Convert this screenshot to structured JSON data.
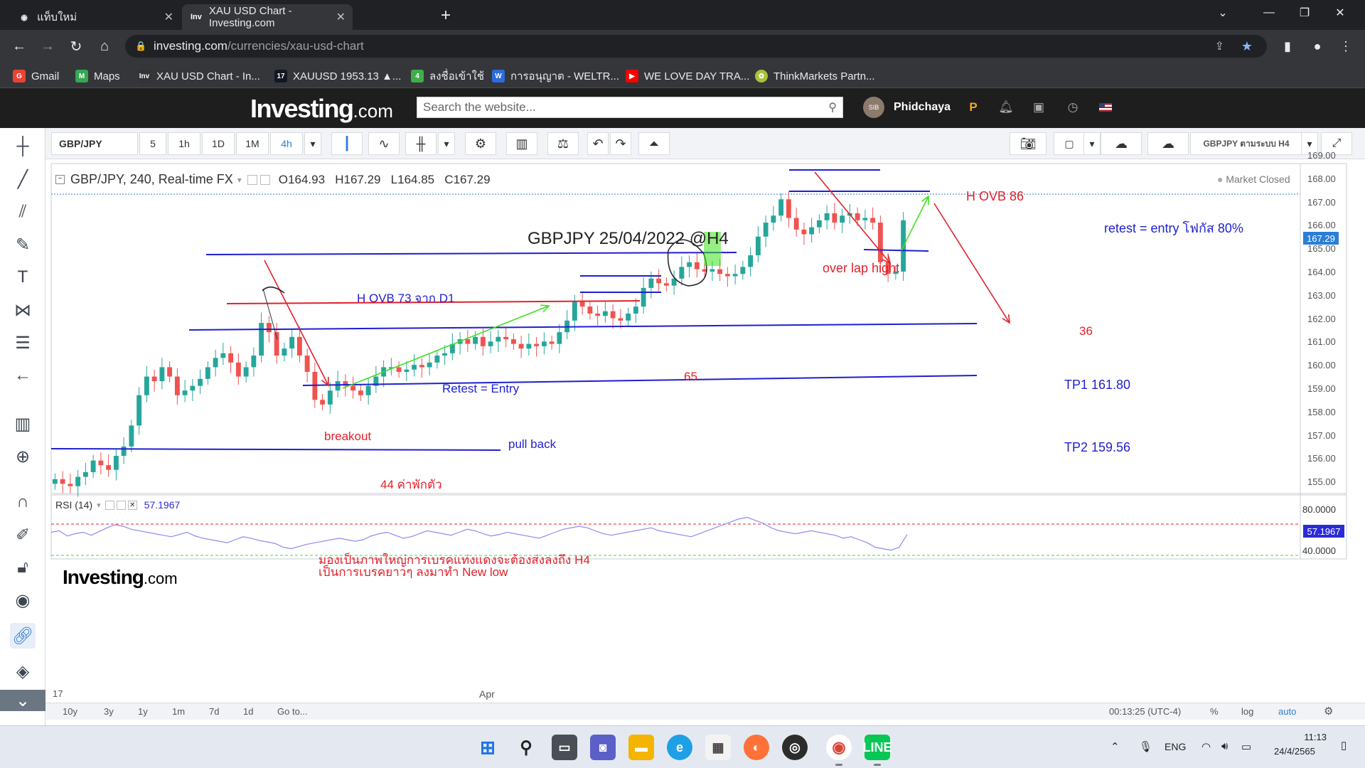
{
  "browser": {
    "tabs": [
      {
        "label": "แท็บใหม่",
        "active": false
      },
      {
        "label": "XAU USD Chart - Investing.com",
        "active": true
      }
    ],
    "url_host": "investing.com",
    "url_path": "/currencies/xau-usd-chart",
    "bookmarks": [
      {
        "label": "Gmail",
        "icon": "gmail-icon",
        "color": "#ea4335"
      },
      {
        "label": "Maps",
        "icon": "maps-icon",
        "color": "#34a853"
      },
      {
        "label": "XAU USD Chart - In...",
        "icon": "investing-icon",
        "color": "#333333"
      },
      {
        "label": "XAUUSD 1953.13 ▲...",
        "icon": "tradingview-icon",
        "color": "#131722"
      },
      {
        "label": "ลงชื่อเข้าใช้",
        "icon": "signin-icon",
        "color": "#3fae49"
      },
      {
        "label": "การอนุญาต - WELTR...",
        "icon": "weltrade-icon",
        "color": "#2d6cdf"
      },
      {
        "label": "WE LOVE DAY TRA...",
        "icon": "youtube-icon",
        "color": "#ff0000"
      },
      {
        "label": "ThinkMarkets Partn...",
        "icon": "thinkmarkets-icon",
        "color": "#a8c239"
      }
    ]
  },
  "site": {
    "logo_main": "Investing",
    "logo_suffix": ".com",
    "search_placeholder": "Search the website...",
    "user_name": "Phidchaya",
    "avatar_text": "SIB"
  },
  "toolbar": {
    "symbol": "GBP/JPY",
    "intervals": [
      "5",
      "1h",
      "1D",
      "1M",
      "4h"
    ],
    "active_interval": "4h",
    "template": "GBPJPY ตามระบบ H4"
  },
  "chart": {
    "header_symbol": "GBP/JPY, 240, Real-time FX",
    "ohlc": {
      "o_label": "O",
      "o": "164.93",
      "h_label": "H",
      "h": "167.29",
      "l_label": "L",
      "l": "164.85",
      "c_label": "C",
      "c": "167.29"
    },
    "market_status": "Market Closed",
    "title_annotation": "GBPJPY 25/04/2022 @H4",
    "watermark_main": "Investing",
    "watermark_suffix": ".com",
    "price_labels": [
      "169.00",
      "168.00",
      "167.00",
      "166.00",
      "165.00",
      "164.00",
      "163.00",
      "162.00",
      "161.00",
      "160.00",
      "159.00",
      "158.00",
      "157.00",
      "156.00",
      "155.00"
    ],
    "last_price": "167.29",
    "annotations": {
      "h_ovb_73": "H OVB 73 จาก D1",
      "breakout": "breakout",
      "retest_entry": "Retest = Entry",
      "pull_back": "pull back",
      "n44": "44 ค่าพักตัว",
      "n65": "65",
      "over_lap": "over lap hight",
      "h_ovb_86": "H OVB 86",
      "retest_focus": "retest = entry โฟกัส 80%",
      "n36": "36",
      "tp1": "TP1 161.80",
      "tp2": "TP2 159.56",
      "note_line1": "มองเป็นภาพใหญ่การเบรคแท่งแดงจะต้องส่งลงถึง H4",
      "note_line2": "เป็นการเบรคยาวๆ ลงมาทำ New low"
    },
    "colors": {
      "up": "#26a69a",
      "down": "#ef5350",
      "blue_line": "#1f1fd1",
      "red_line": "#e3202a",
      "green_arrow": "#3ee11e"
    }
  },
  "rsi": {
    "label": "RSI (14)",
    "value": "57.1967",
    "levels": [
      "80.0000",
      "40.0000"
    ],
    "value_tag": "57.1967"
  },
  "time_axis": {
    "labels": [
      "17",
      "Apr"
    ]
  },
  "bottom": {
    "ranges": [
      "10y",
      "3y",
      "1y",
      "1m",
      "7d",
      "1d"
    ],
    "goto": "Go to...",
    "clock": "00:13:25 (UTC-4)",
    "pct": "%",
    "log": "log",
    "auto": "auto"
  },
  "taskbar": {
    "lang": "ENG",
    "time": "11:13",
    "date": "24/4/2565"
  }
}
